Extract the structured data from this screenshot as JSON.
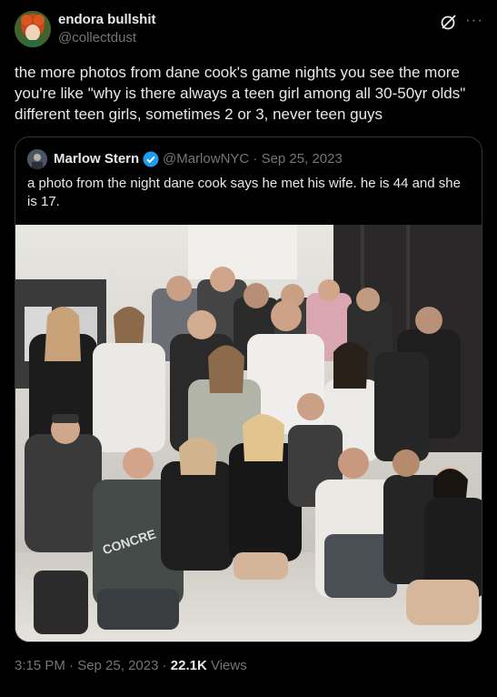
{
  "author": {
    "name": "endora bullshit",
    "handle": "@collectdust"
  },
  "tweet": {
    "text": "the more photos from dane cook's game nights you see the more\nyou're like \"why is there always a teen girl among all 30-50yr olds\"\ndifferent teen girls, sometimes 2 or 3, never teen guys"
  },
  "quoted": {
    "name": "Marlow Stern",
    "handle_date": "@MarlowNYC · Sep 25, 2023",
    "text": "a photo from the night dane cook says he met his wife. he is 44 and she is 17.",
    "photo_shirt_text": "CONCRE"
  },
  "footer": {
    "time_date": "3:15 PM · Sep 25, 2023 · ",
    "views_count": "22.1K",
    "views_label": " Views"
  },
  "icons": {
    "grok": "grok-icon",
    "more": "more-icon",
    "verified": "verified-icon"
  },
  "colors": {
    "background": "#000000",
    "text": "#e7e9ea",
    "secondary": "#71767b",
    "border": "#2f3336",
    "verified": "#1d9bf0"
  }
}
